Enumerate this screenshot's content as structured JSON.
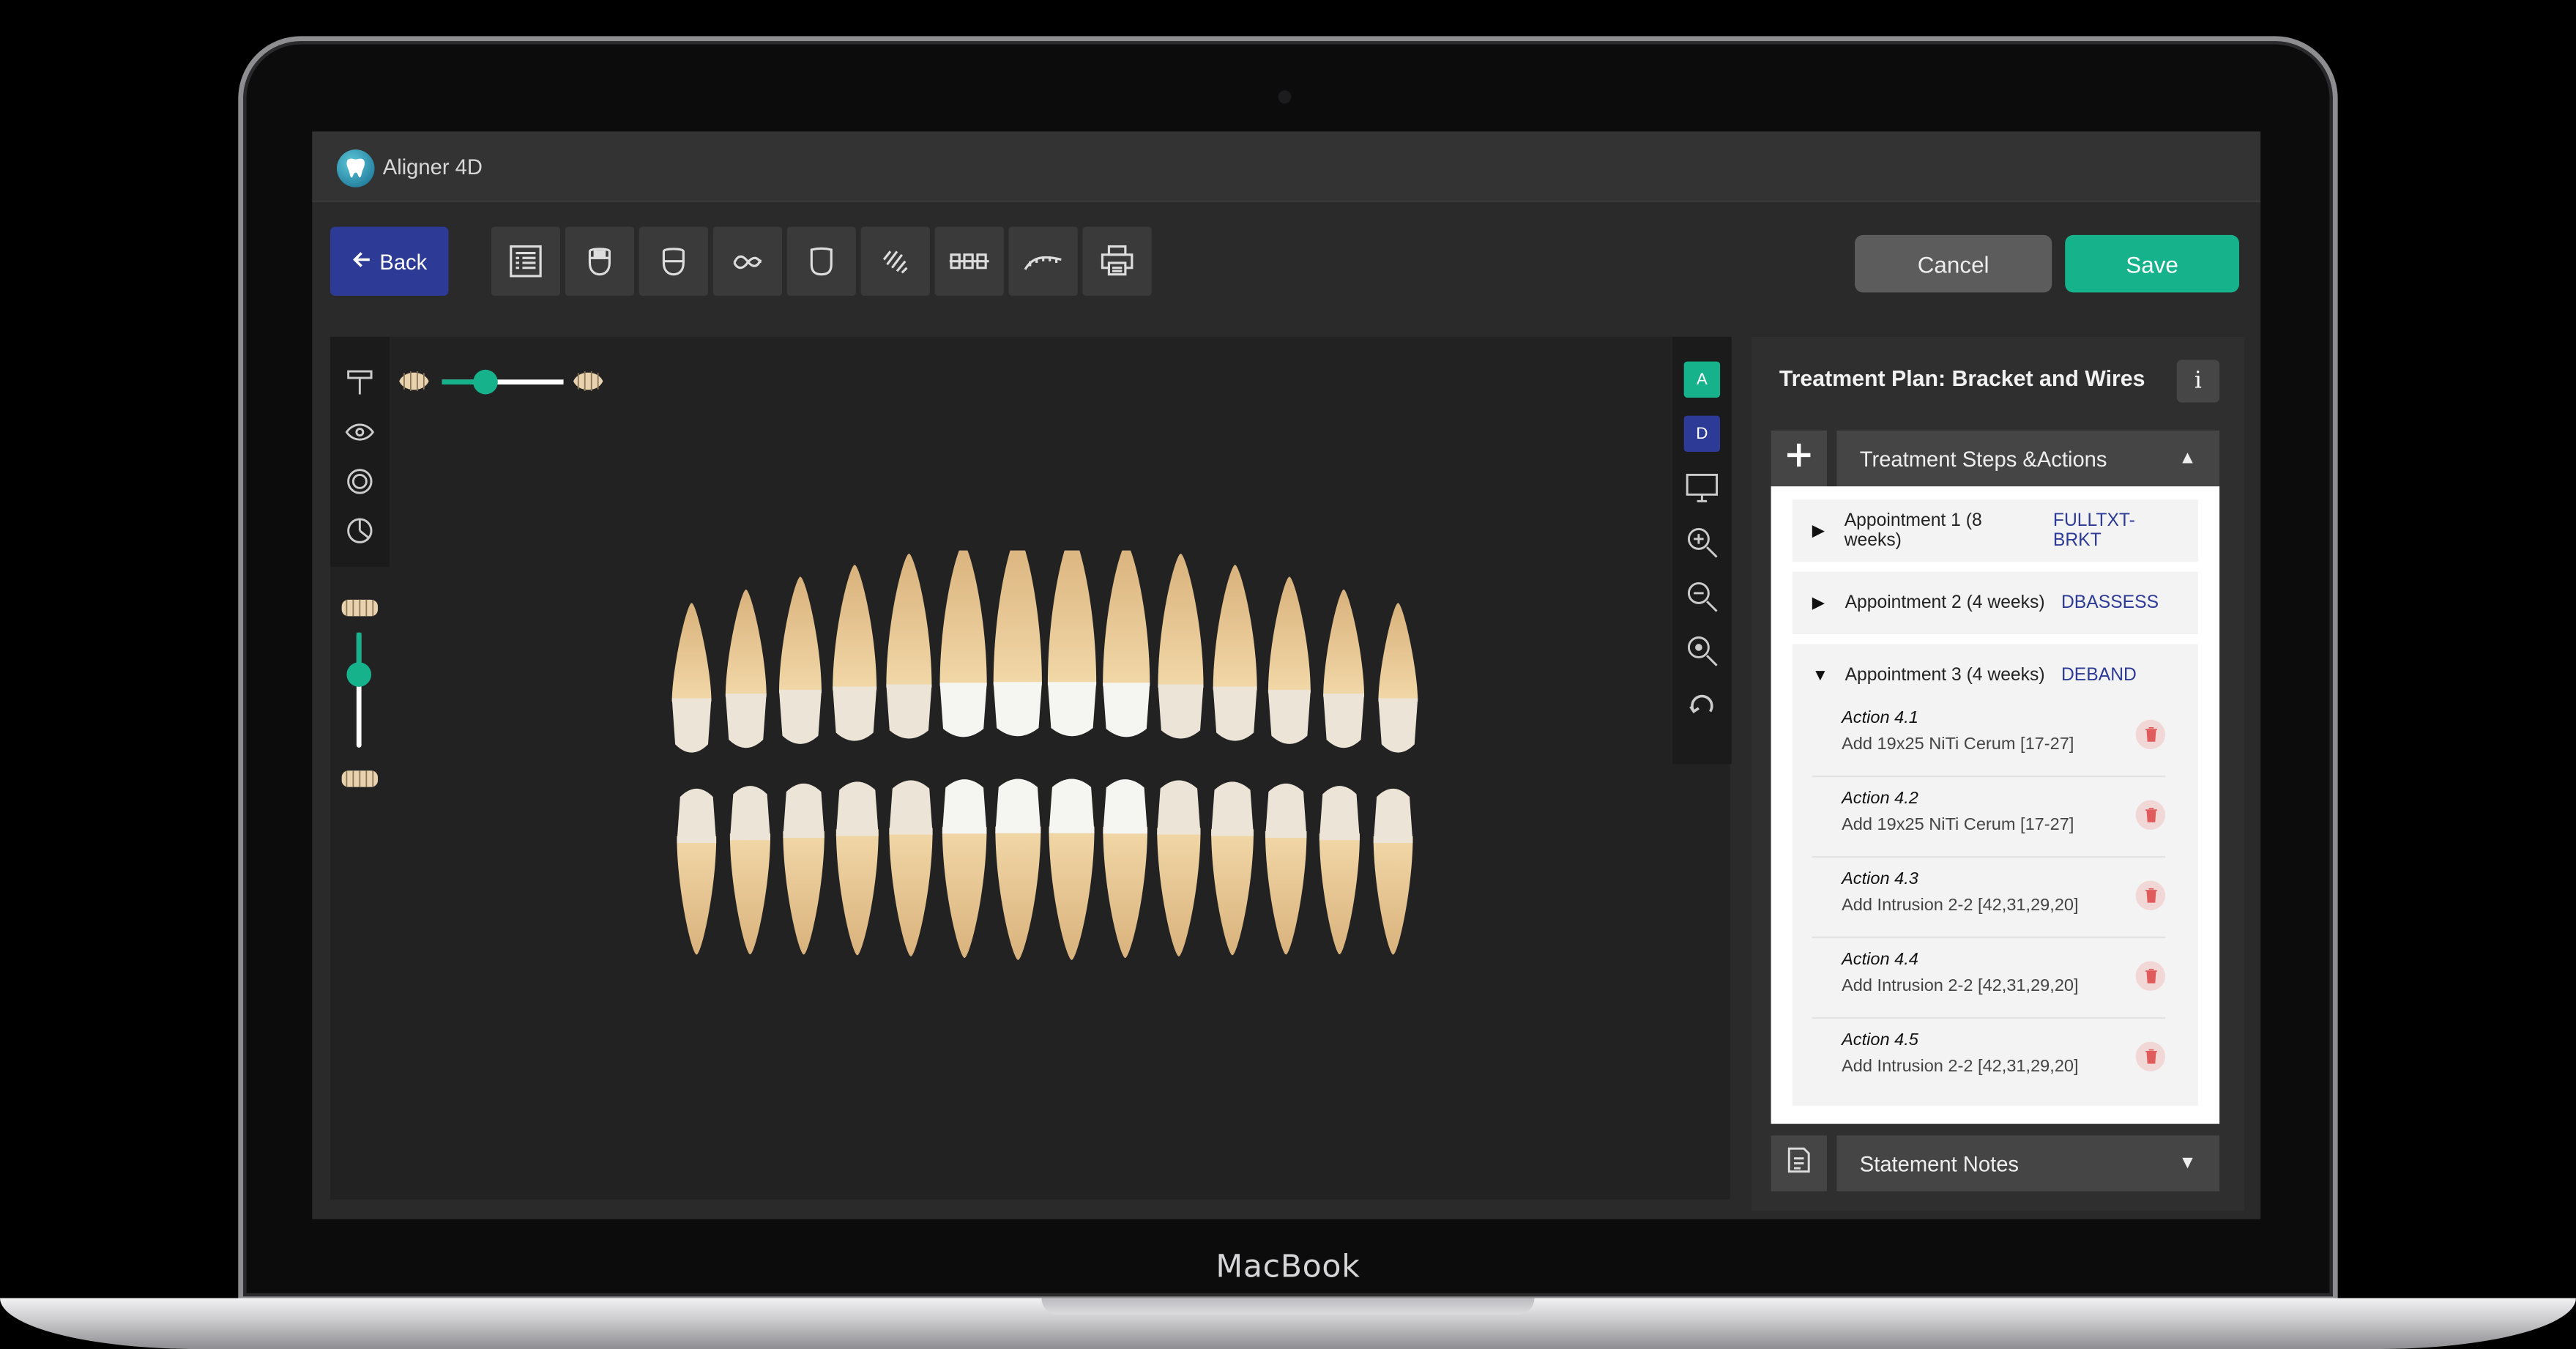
{
  "device": {
    "brand": "MacBook"
  },
  "app": {
    "title": "Aligner 4D"
  },
  "toolbar": {
    "back_label": "Back",
    "cancel_label": "Cancel",
    "save_label": "Save",
    "tools": [
      "document-list-icon",
      "upper-jaw-icon",
      "lower-jaw-icon",
      "arch-link-icon",
      "tooth-icon",
      "spring-icon",
      "brackets-icon",
      "wire-icon",
      "printer-icon"
    ]
  },
  "viewport": {
    "left_tools": [
      "paint-roller-icon",
      "eye-icon",
      "ring-icon",
      "pie-icon"
    ],
    "right_tools": {
      "badge_a": "A",
      "badge_d": "D",
      "icons": [
        "monitor-icon",
        "zoom-in-icon",
        "zoom-out-icon",
        "zoom-fit-icon",
        "rotate-icon"
      ]
    },
    "opacity_slider_level": 0.35,
    "jaw_slider_level": 0.35
  },
  "panel": {
    "title": "Treatment Plan: Bracket and Wires",
    "info_label": "i",
    "steps_header": "Treatment Steps &Actions",
    "notes_header": "Statement Notes",
    "appointments": [
      {
        "label": "Appointment 1 (8 weeks)",
        "code": "FULLTXT-BRKT",
        "expanded": false
      },
      {
        "label": "Appointment 2 (4 weeks)",
        "code": "DBASSESS",
        "expanded": false
      },
      {
        "label": "Appointment 3 (4 weeks)",
        "code": "DEBAND",
        "expanded": true
      }
    ],
    "actions": [
      {
        "title": "Action 4.1",
        "desc": "Add 19x25 NiTi Cerum [17-27]"
      },
      {
        "title": "Action 4.2",
        "desc": "Add 19x25 NiTi Cerum [17-27]"
      },
      {
        "title": "Action 4.3",
        "desc": "Add Intrusion 2-2 [42,31,29,20]"
      },
      {
        "title": "Action 4.4",
        "desc": "Add Intrusion 2-2 [42,31,29,20]"
      },
      {
        "title": "Action 4.5",
        "desc": "Add Intrusion 2-2 [42,31,29,20]"
      }
    ]
  },
  "colors": {
    "accent": "#16b28c",
    "primary": "#2d3b96",
    "background": "#2a2a2a"
  }
}
